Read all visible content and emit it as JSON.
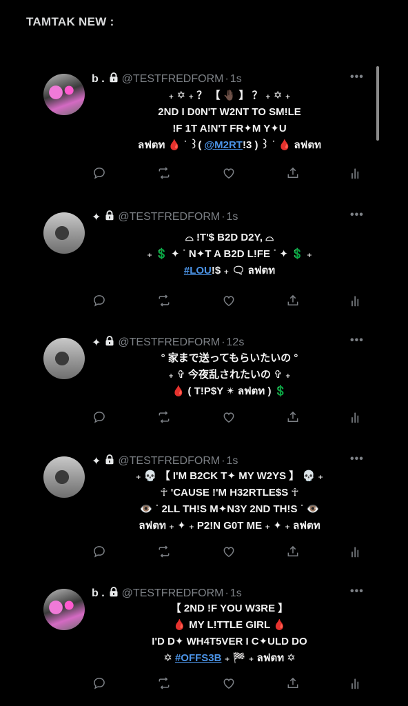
{
  "page": {
    "title": "TAMTAK NEW :"
  },
  "tweets": [
    {
      "name": "b .",
      "handle": "@TESTFREDFORM",
      "time": "1s",
      "avatar": "pink",
      "lines": [
        [
          {
            "t": "₊ ✡︎ ₊ ？ 【 🤚🏿 】 ？ ₊ ✡︎ ₊"
          }
        ],
        [
          {
            "t": "2ND I D0N'T W2NT TO SM!LE"
          }
        ],
        [
          {
            "t": "!F 1T A!N'T FR✦M Y✦U"
          }
        ],
        [
          {
            "t": "ลฟตท 🩸 ˙ ꒱( "
          },
          {
            "t": "@M2RT",
            "link": true
          },
          {
            "t": "!3 ) ꒱ ˙ 🩸 ลฟตท"
          }
        ]
      ]
    },
    {
      "name": "✦",
      "handle": "@TESTFREDFORM",
      "time": "1s",
      "avatar": "gray",
      "lines": [
        [
          {
            "t": "⌓   !T'$ B2D D2Y,   ⌓"
          }
        ],
        [
          {
            "t": "₊ 💲 ✦ ˙   N✦T A B2D L!FE   ˙ ✦ 💲 ₊"
          }
        ],
        [
          {
            "t": "#LOU",
            "link": true
          },
          {
            "t": "!$ ₊ 🗨 ลฟตท"
          }
        ]
      ]
    },
    {
      "name": "✦",
      "handle": "@TESTFREDFORM",
      "time": "12s",
      "avatar": "gray",
      "lines": [
        [
          {
            "t": "° 家まで送ってもらいたいの °"
          }
        ],
        [
          {
            "t": "₊ ✞ 今夜乱されたいの ✞ ₊"
          }
        ],
        [
          {
            "t": "🩸   ( T!P$Y ✴ ลฟตท )   💲"
          }
        ]
      ]
    },
    {
      "name": "✦",
      "handle": "@TESTFREDFORM",
      "time": "1s",
      "avatar": "gray",
      "lines": [
        [
          {
            "t": "₊ 💀 【 I'M B2CK T✦ MY W2YS 】 💀 ₊"
          }
        ],
        [
          {
            "t": "☥   'CAUSE !'M H32RTLE$S   ☥"
          }
        ],
        [
          {
            "t": "👁️ ˙ 2LL TH!S M✦N3Y 2ND TH!S ˙ 👁️"
          }
        ],
        [
          {
            "t": "ลฟตท ₊ ✦ ₊ P2!N G0T ME ₊ ✦ ₊ ลฟตท"
          }
        ]
      ]
    },
    {
      "name": "b .",
      "handle": "@TESTFREDFORM",
      "time": "1s",
      "avatar": "pink",
      "lines": [
        [
          {
            "t": "【   2ND !F YOU W3RE   】"
          }
        ],
        [
          {
            "t": "🩸   MY L!TTLE GIRL   🩸"
          }
        ],
        [
          {
            "t": "I'D D✦ WH4T5VER I C✦ULD DO"
          }
        ],
        [
          {
            "t": "✡︎   "
          },
          {
            "t": "#OFFS3B",
            "link": true
          },
          {
            "t": " ₊ 🏁 ₊ ลฟตท   ✡︎"
          }
        ]
      ]
    }
  ],
  "icons": {
    "reply": "reply-icon",
    "retweet": "retweet-icon",
    "like": "heart-icon",
    "share": "share-icon",
    "views": "views-icon",
    "more": "more-icon",
    "lock": "lock-icon"
  },
  "colors": {
    "background": "#000000",
    "text": "#e7e9ea",
    "muted": "#7d8186",
    "link": "#4b93e6"
  }
}
